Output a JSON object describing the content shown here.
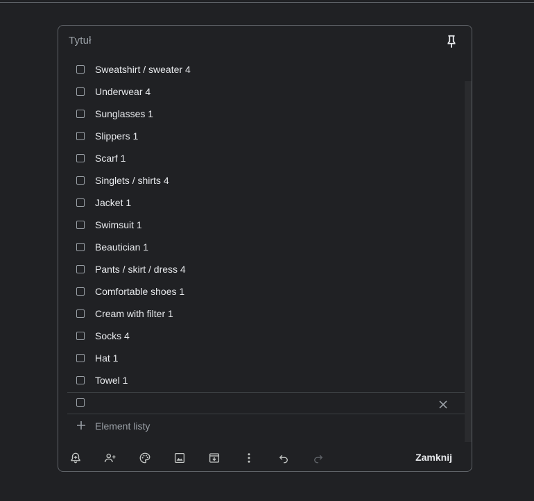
{
  "note": {
    "title_placeholder": "Tytuł",
    "items": [
      {
        "label": "Sweatshirt / sweater 4"
      },
      {
        "label": "Underwear 4"
      },
      {
        "label": "Sunglasses 1"
      },
      {
        "label": "Slippers 1"
      },
      {
        "label": "Scarf 1"
      },
      {
        "label": "Singlets / shirts 4"
      },
      {
        "label": "Jacket 1"
      },
      {
        "label": "Swimsuit 1"
      },
      {
        "label": "Beautician 1"
      },
      {
        "label": "Pants / skirt / dress 4"
      },
      {
        "label": "Comfortable shoes 1"
      },
      {
        "label": "Cream with filter 1"
      },
      {
        "label": "Socks 4"
      },
      {
        "label": "Hat 1"
      },
      {
        "label": "Towel 1"
      }
    ],
    "new_item_value": "",
    "add_item_label": "Element listy",
    "close_label": "Zamknij"
  },
  "toolbar": {
    "icons": [
      "bell-plus-icon",
      "person-add-icon",
      "palette-icon",
      "image-icon",
      "archive-icon",
      "more-vert-icon",
      "undo-icon",
      "redo-icon"
    ]
  },
  "colors": {
    "background": "#202124",
    "border": "#5f6368",
    "text": "#e8eaed",
    "muted": "#9aa0a6"
  }
}
